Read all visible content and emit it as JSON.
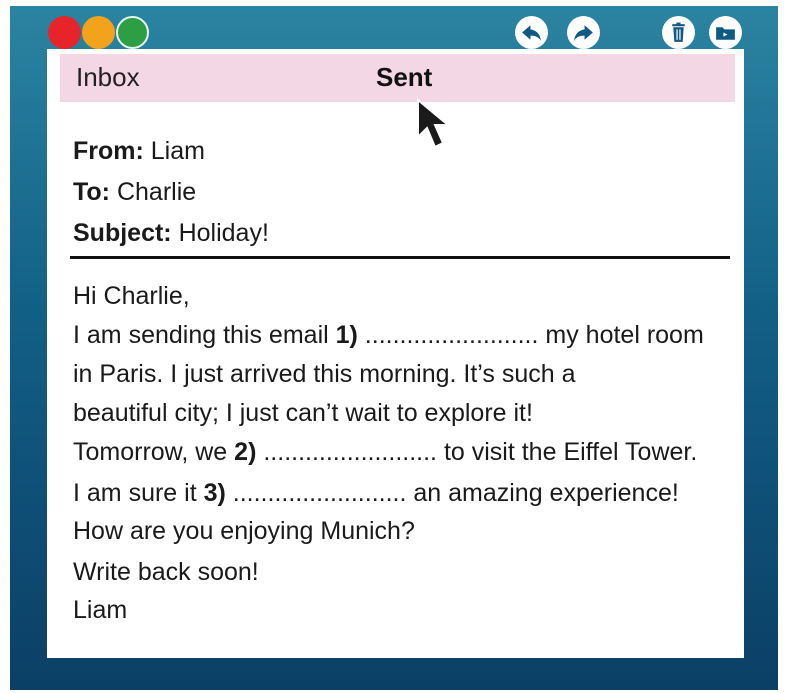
{
  "toolbar": {
    "icons": [
      "reply-icon",
      "forward-icon",
      "trash-icon",
      "folder-icon"
    ],
    "colors": {
      "red": "#e8242b",
      "yellow": "#f2a31b",
      "green": "#2d9e43"
    }
  },
  "tabs": {
    "inbox": "Inbox",
    "sent": "Sent"
  },
  "email": {
    "from_label": "From:",
    "from_value": "Liam",
    "to_label": "To:",
    "to_value": "Charlie",
    "subject_label": "Subject:",
    "subject_value": "Holiday!",
    "greeting": "Hi Charlie,",
    "l1a": "I am sending this email ",
    "l1n": "1)",
    "l1b": " ......................... my hotel room",
    "l2": "in Paris. I just arrived this morning. It’s such  a",
    "l3": "beautiful city; I just can’t wait to explore it!",
    "l4a": "Tomorrow, we ",
    "l4n": "2)",
    "l4b": " ......................... to visit the Eiffel Tower.",
    "l5a": "I am sure it ",
    "l5n": "3)",
    "l5b": " ......................... an amazing experience!",
    "l6": "How are you enjoying Munich?",
    "l7": "Write back soon!",
    "signature": "Liam"
  }
}
